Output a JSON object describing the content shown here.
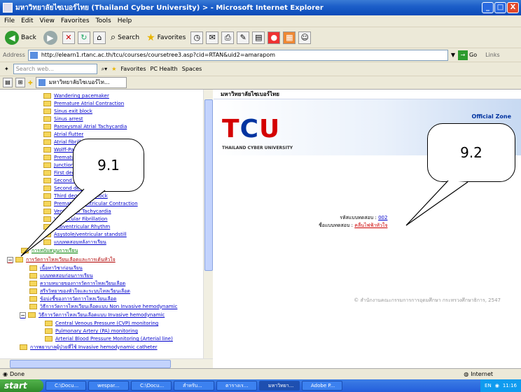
{
  "window": {
    "title": "มหาวิทยาลัยไซเบอร์ไทย (Thailand Cyber University) > - Microsoft Internet Explorer",
    "minimize": "_",
    "maximize": "□",
    "close": "X"
  },
  "menu": [
    "File",
    "Edit",
    "View",
    "Favorites",
    "Tools",
    "Help"
  ],
  "toolbar": {
    "back_label": "Back",
    "search_label": "Search",
    "favorites_label": "Favorites"
  },
  "address": {
    "label": "Address",
    "url": "http://elearn1.rtanc.ac.th/tcu/courses/coursetree3.asp?cid=RTAN&uid2=amarapom",
    "go_label": "Go",
    "links_label": "Links"
  },
  "linksbar": {
    "search_placeholder": "Search web...",
    "favorites": "Favorites",
    "pchealth": "PC Health",
    "spaces": "Spaces"
  },
  "tab": {
    "label": "มหาวิทยาลัยไซเบอร์ไท..."
  },
  "tree": {
    "items": [
      "Wandering pacemaker",
      "Premature Atrial Contraction",
      "Sinus exit block",
      "Sinus arrest",
      "Paroxysmal Atrial Tachycardia",
      "Atrial flutter",
      "Atrial fibrillation",
      "Wolff-Parkinson-White",
      "Premature Junctional Contraction",
      "Junctional Rhythm",
      "First degree AV block",
      "Second degree AV block, type I",
      "Second degree AV block, type II",
      "Third degree AV block",
      "Premature Ventricular Contraction",
      "Ventricular Tachycardia",
      "Ventricular Fibrillation",
      "Idioventricular Rhythm",
      "Asystole/ventricular standstill",
      "แบบทดสอบหลังการเรียน"
    ],
    "section_nav": "การสนับสนุนการเรียน",
    "section2": "การวัดการไหลเวียนเลือดและการเต้นหัวใจ",
    "sub_items": [
      "เนื้อหาวิชาก่อนเรียน",
      "แบบทดสอบก่อนการเรียน",
      "ความหมายของการวัดการไหลเวียนเลือด",
      "สรีรวิทยาของหัวใจและระบบไหลเวียนเลือด",
      "ข้อบ่งชี้ของการวัดการไหลเวียนเลือด",
      "วิธีการวัดการไหลเวียนเลือดแบบ Non Invasive hemodynamic"
    ],
    "invasive": "วิธีการวัดการไหลเวียนเลือดแบบ Invasive hemodynamic",
    "invasive_items": [
      "Central Venous Pressure (CVP) monitoring",
      "Pulmonary Artery (PA) monitoring",
      "Arterial Blood Pressure Monitoring (Arterial line)"
    ],
    "last": "การพยาบาลผู้ป่วยที่ใช้ Invasive hemodynamic catheter"
  },
  "content": {
    "site_header": "มหาวิทยาลัยไซเบอร์ไทย",
    "logo_t": "T",
    "logo_c": "C",
    "logo_u": "U",
    "logo_sub": "THAILAND CYBER UNIVERSITY",
    "official": "Official Zone",
    "code_label": "รหัสแบบทดสอบ :",
    "code_value": "002",
    "name_label": "ชื่อแบบทดสอบ :",
    "name_value": "คลื่นไฟฟ้าหัวใจ",
    "copyright": "© สำนักงานคณะกรรมการการอุดมศึกษา กระทรวงศึกษาธิการ, 2547"
  },
  "annotations": {
    "left": "9.1",
    "right": "9.2"
  },
  "status": {
    "left": "Done",
    "zone": "Internet"
  },
  "taskbar": {
    "start": "start",
    "tasks": [
      "C:\\Docu...",
      "wespar...",
      "C:\\Docu...",
      "สำหรับ...",
      "ตารางเร...",
      "มหาวิทยา...",
      "Adobe P..."
    ],
    "lang": "EN",
    "clock": "11:16"
  }
}
